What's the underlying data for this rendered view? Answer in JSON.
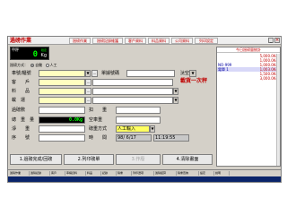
{
  "titlebar": {
    "title": "過磅作業",
    "buttons": [
      "過磅作業",
      "過磅記錄維護",
      "客戶資料",
      "料品資料",
      "公司資料",
      "列印設定"
    ]
  },
  "scale": {
    "tag": "甲秤",
    "mark": "穩定",
    "weight": "0",
    "unit": "Kg"
  },
  "mode": {
    "label": "過磅方式：",
    "options": [
      "自動",
      "人工"
    ]
  },
  "form": {
    "vehicle_label": "車號/櫃號",
    "ticket_label": "單據號碼",
    "ticket_value": "",
    "empty_btn": "汰空",
    "accent": "載貨一次秤",
    "customer_label": "客　　戶",
    "product_label": "料　　品",
    "carrier_label": "載　運",
    "scale_no_label": "過磅數",
    "deduct_label": "扣　　重",
    "weight_label": "總　重　量",
    "weight_value": "0.0Kg",
    "empty_weight_label": "空車重",
    "net_label": "淨　　重",
    "mode2_label": "磅重方式",
    "mode2_value": "人工輸入",
    "serial_label": "序　　號",
    "time_label": "時　　間",
    "date_value": "98/ 6/17",
    "time_value": "11:19:55"
  },
  "actions": [
    "1.過磅完成/回磅",
    "2.列印磅單",
    "3.作廢",
    "4.清除畫面"
  ],
  "status": [
    "過磅作業",
    "過磅記錄",
    "客戶",
    "車輛資料",
    "料品",
    "記錄",
    "磅重",
    "列印選項",
    "過磅結算",
    "磅重查詢",
    "設定",
    "說明"
  ],
  "right_panel": {
    "title": "今日過磅量統計",
    "rows": [
      {
        "c1": "",
        "c2": "5,000.0Kg",
        "hl": false
      },
      {
        "c1": "",
        "c2": "1,000.0Kg",
        "hl": false
      },
      {
        "c1": "NO-999",
        "c2": "1,000.0Kg",
        "hl": false
      },
      {
        "c1": "電單 1",
        "c2": "1,003.0Kg",
        "hl": true
      },
      {
        "c1": "",
        "c2": "1,500.0Kg",
        "hl": false
      },
      {
        "c1": "",
        "c2": "3,000.0Kg",
        "hl": false
      }
    ]
  }
}
